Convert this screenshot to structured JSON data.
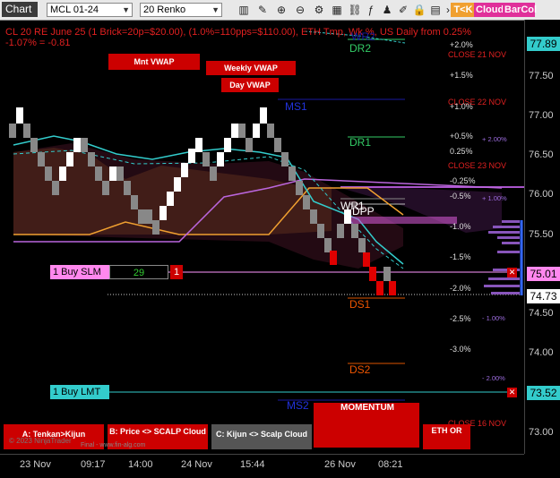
{
  "toolbar": {
    "title": "Chart",
    "instrument": "MCL 01-24",
    "bar_type": "20 Renko",
    "icons": [
      "bar-style-icon",
      "draw-icon",
      "zoom-in-icon",
      "zoom-out-icon",
      "properties-icon",
      "data-box-icon",
      "instrument-link-icon",
      "indicators-icon",
      "strategies-icon",
      "drawing-tools-icon",
      "lock-icon",
      "chart-trader-icon",
      "prev-icon",
      "next-icon"
    ],
    "buttons": [
      {
        "label": "T<K",
        "color": "#f0a030"
      },
      {
        "label": "Cloud",
        "color": "#e0309a"
      },
      {
        "label": "BarCol",
        "color": "#e0309a"
      }
    ]
  },
  "header": {
    "line1": "CL 20 RE June 25 (1 Brick=20p=$20.00), (1.0%=110pps=$110.00), ETH Tmp, Wk %, US Daily from 0.25%",
    "line2": "-1.07% = -0.81"
  },
  "vwap_labels": {
    "monthly": "Mnt VWAP",
    "weekly": "Weekly VWAP",
    "daily": "Day VWAP"
  },
  "pivot_labels": {
    "wr2": "WR2",
    "dr2": "DR2",
    "ms1": "MS1",
    "dr1": "DR1",
    "wr1": "WR1",
    "dpp": "DPP",
    "ds1": "DS1",
    "ds2": "DS2",
    "ms2": "MS2"
  },
  "close_labels": [
    "CLOSE 21 NOV",
    "CLOSE 22 NOV",
    "CLOSE 23 NOV",
    "CLOSE 16 NOV"
  ],
  "percent_levels": [
    "+2.0%",
    "+1.5%",
    "+1.0%",
    "+0.5%",
    "0.25%",
    "-0.25%",
    "-0.5%",
    "-1.0%",
    "-1.5%",
    "-2.0%",
    "-2.5%",
    "-3.0%"
  ],
  "weekly_percents": [
    "+ 2.00%",
    "+ 1.00%",
    "- 1.00%",
    "- 2.00%"
  ],
  "price_axis": [
    "77.89",
    "77.50",
    "77.00",
    "76.50",
    "76.00",
    "75.50",
    "75.01",
    "74.73",
    "74.50",
    "74.00",
    "73.52",
    "73.00"
  ],
  "price_tags": {
    "current": "75.01",
    "last": "74.73",
    "limit": "73.52"
  },
  "time_axis": [
    "23 Nov",
    "09:17",
    "14:00",
    "24 Nov",
    "15:44",
    "26 Nov",
    "08:21"
  ],
  "orders": {
    "buy_slm": {
      "label": "1 Buy SLM",
      "qty": "29",
      "count": "1"
    },
    "buy_lmt": {
      "label": "1 Buy LMT"
    }
  },
  "momentum_label": "MOMENTUM",
  "bottom_buttons": [
    {
      "label": "A: Tenkan>Kijun",
      "color": "#cc0000"
    },
    {
      "label": "B: Price <> SCALP Cloud",
      "color": "#cc0000"
    },
    {
      "label": "C: Kijun <> Scalp Cloud",
      "color": "#555555"
    },
    {
      "label": "ETH OR",
      "color": "#cc0000"
    }
  ],
  "watermark": "© 2023 NinjaTrader",
  "footer_note": "Final - www.fin-alg.com",
  "colors": {
    "red_btn": "#cc0000",
    "cyan": "#33cccc",
    "magenta": "#ff55ff",
    "purple": "#9b59d0",
    "orange": "#f0a030",
    "brick_up": "#ffffff",
    "brick_down": "#888888"
  }
}
